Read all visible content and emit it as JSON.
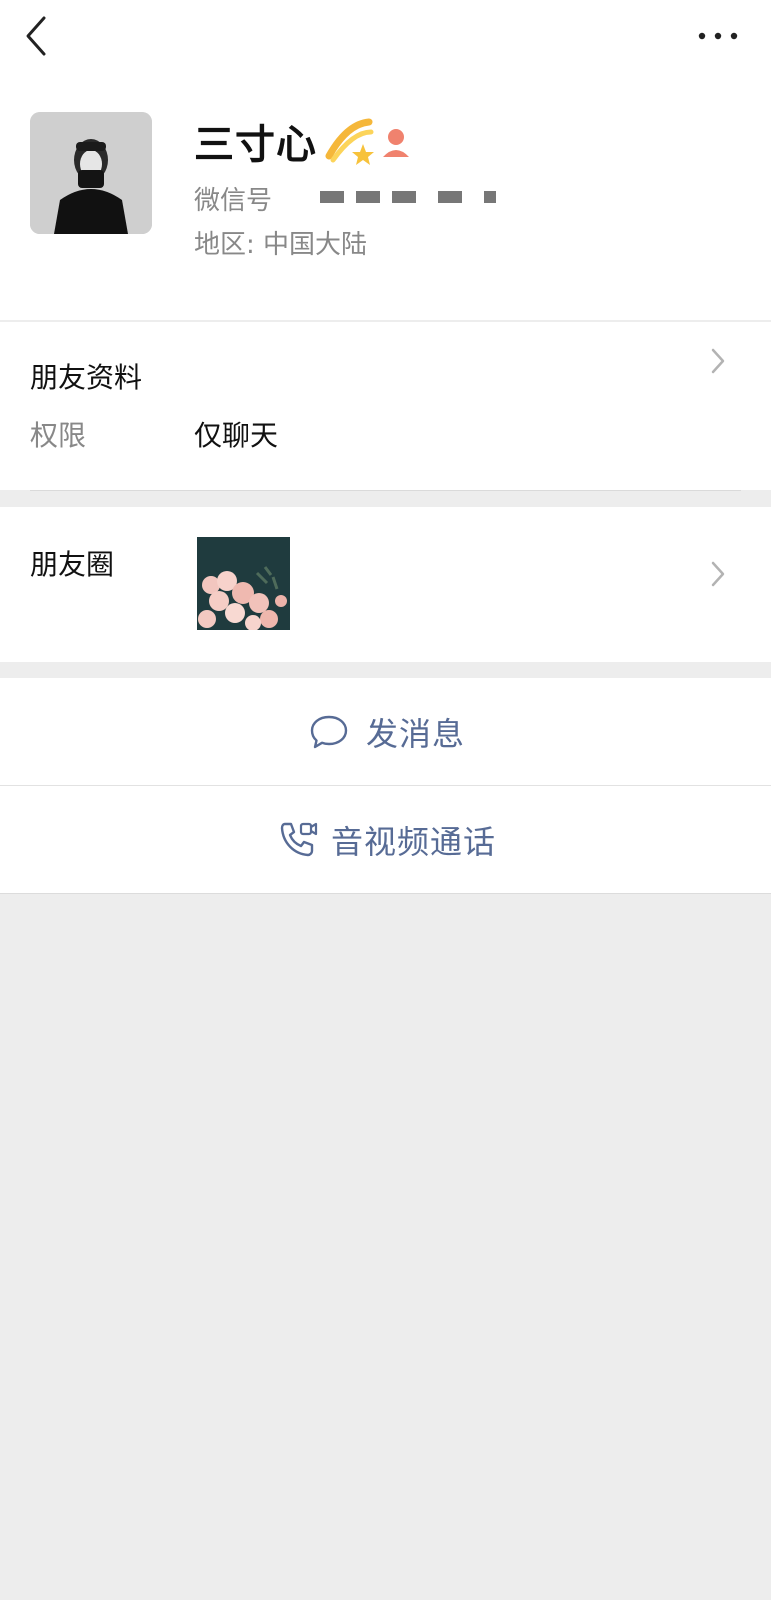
{
  "topbar": {
    "back_icon": "chevron-left-icon",
    "more_icon": "more-horizontal-icon"
  },
  "profile": {
    "nickname": "三寸心",
    "badge_icons": [
      "shooting-star-emoji-icon",
      "gender-female-icon"
    ],
    "wechat_id_label": "微信号",
    "region_text": "地区: 中国大陆"
  },
  "friend_info": {
    "title": "朋友资料",
    "permission_label": "权限",
    "permission_value": "仅聊天"
  },
  "moments": {
    "label": "朋友圈"
  },
  "actions": {
    "send_message": "发消息",
    "av_call": "音视频通话"
  },
  "colors": {
    "accent": "#576b95",
    "page_bg": "#ededed",
    "gender_badge": "#f0826e"
  }
}
